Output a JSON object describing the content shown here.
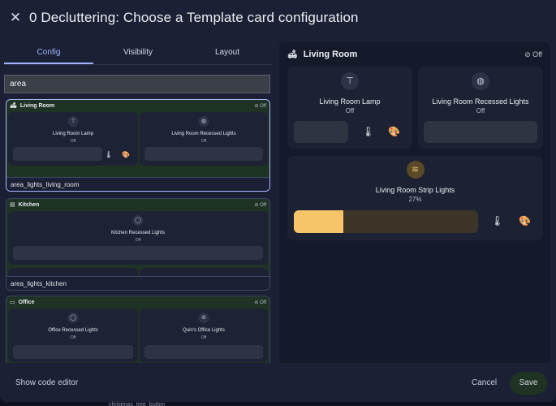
{
  "dialog": {
    "title": "0 Decluttering: Choose a Template card configuration",
    "tabs": [
      "Config",
      "Visibility",
      "Layout"
    ],
    "search_value": "area"
  },
  "results": [
    {
      "area": "Living Room",
      "status": "Off",
      "template": "area_lights_living_room",
      "tiles": [
        {
          "name": "Living Room Lamp",
          "state": "Off"
        },
        {
          "name": "Living Room Recessed Lights",
          "state": "Off"
        }
      ]
    },
    {
      "area": "Kitchen",
      "status": "Off",
      "template": "area_lights_kitchen",
      "tiles": [
        {
          "name": "Kitchen Recessed Lights",
          "state": "Off"
        }
      ]
    },
    {
      "area": "Office",
      "status": "Off",
      "tiles": [
        {
          "name": "Office Recessed Lights",
          "state": "Off"
        },
        {
          "name": "Quin's Office Lights",
          "state": "Off"
        }
      ]
    }
  ],
  "preview": {
    "area": "Living Room",
    "status": "Off",
    "tiles": [
      {
        "name": "Living Room Lamp",
        "state": "Off"
      },
      {
        "name": "Living Room Recessed Lights",
        "state": "Off"
      },
      {
        "name": "Living Room Strip Lights",
        "state": "27%",
        "brightness_pct": 27
      }
    ]
  },
  "footer": {
    "show_code_label": "Show code editor",
    "cancel_label": "Cancel",
    "save_label": "Save"
  },
  "background_text": "christmas_tree_button",
  "colors": {
    "accent": "#9fb4ff",
    "light_on": "#f6c56a",
    "card_bg": "#1c2233",
    "dialog_bg": "#1b2034"
  }
}
